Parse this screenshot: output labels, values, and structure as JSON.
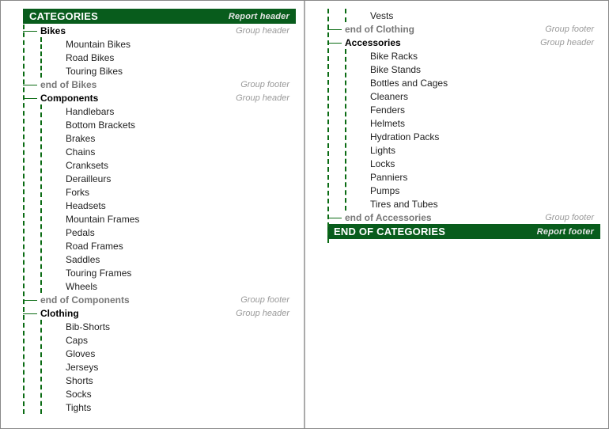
{
  "reportHeader": {
    "title": "CATEGORIES",
    "ann": "Report header"
  },
  "reportFooter": {
    "title": "END OF CATEGORIES",
    "ann": "Report footer"
  },
  "annotations": {
    "groupHeader": "Group header",
    "groupFooter": "Group footer"
  },
  "col1": {
    "groups": [
      {
        "name": "Bikes",
        "endName": "end of Bikes",
        "items": [
          "Mountain Bikes",
          "Road Bikes",
          "Touring Bikes"
        ]
      },
      {
        "name": "Components",
        "endName": "end of Components",
        "items": [
          "Handlebars",
          "Bottom Brackets",
          "Brakes",
          "Chains",
          "Cranksets",
          "Derailleurs",
          "Forks",
          "Headsets",
          "Mountain Frames",
          "Pedals",
          "Road Frames",
          "Saddles",
          "Touring Frames",
          "Wheels"
        ]
      },
      {
        "name": "Clothing",
        "endName": "end of Clothing",
        "items": [
          "Bib-Shorts",
          "Caps",
          "Gloves",
          "Jerseys",
          "Shorts",
          "Socks",
          "Tights"
        ],
        "continues": true
      }
    ]
  },
  "col2": {
    "continuation": {
      "items": [
        "Vests"
      ],
      "endName": "end of Clothing"
    },
    "groups": [
      {
        "name": "Accessories",
        "endName": "end of Accessories",
        "items": [
          "Bike Racks",
          "Bike Stands",
          "Bottles and Cages",
          "Cleaners",
          "Fenders",
          "Helmets",
          "Hydration Packs",
          "Lights",
          "Locks",
          "Panniers",
          "Pumps",
          "Tires and Tubes"
        ]
      }
    ]
  }
}
